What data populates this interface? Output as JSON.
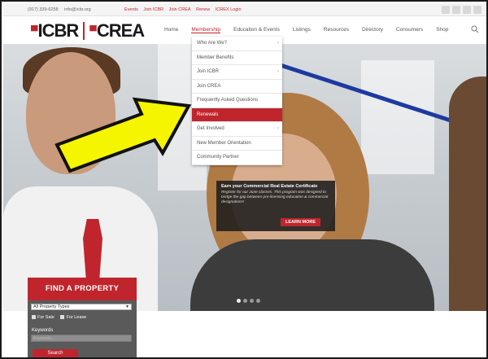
{
  "topbar": {
    "phone": "(917) 339-6258",
    "email": "info@icbr.org",
    "links": [
      "Events",
      "Join ICBR",
      "Join CREA",
      "Renew",
      "ICREX Login"
    ],
    "social": [
      "twitter-icon",
      "facebook-icon",
      "youtube-icon",
      "linkedin-icon"
    ]
  },
  "logo": {
    "left": "ICBR",
    "right": "CREA"
  },
  "nav": {
    "items": [
      "Home",
      "Membership",
      "Education & Events",
      "Listings",
      "Resources",
      "Directory",
      "Consumers",
      "Shop"
    ],
    "active": "Membership"
  },
  "dropdown": {
    "items": [
      {
        "label": "Who Are We?",
        "has_sub": true
      },
      {
        "label": "Member Benefits",
        "has_sub": false
      },
      {
        "label": "Join ICBR",
        "has_sub": true
      },
      {
        "label": "Join CREA",
        "has_sub": false
      },
      {
        "label": "Frequently Asked Questions",
        "has_sub": false
      },
      {
        "label": "Renewals",
        "has_sub": false,
        "active": true
      },
      {
        "label": "Get Involved",
        "has_sub": true
      },
      {
        "label": "New Member Orientation",
        "has_sub": false
      },
      {
        "label": "Community Partner",
        "has_sub": false
      }
    ]
  },
  "promo": {
    "title": "Earn your Commercial Real Estate Certificate",
    "body": "Register for our June classes. This program was designed to bridge the gap between pre-licensing education & commercial designations!",
    "button": "LEARN MORE"
  },
  "finder": {
    "heading": "FIND A PROPERTY",
    "type_select": "All Property Types",
    "for_sale": "For Sale",
    "for_lease": "For Lease",
    "keywords_label": "Keywords",
    "keywords_placeholder": "Keywords...",
    "search_button": "Search"
  },
  "colors": {
    "brand_red": "#c0252d",
    "arrow_yellow": "#f5f500"
  }
}
